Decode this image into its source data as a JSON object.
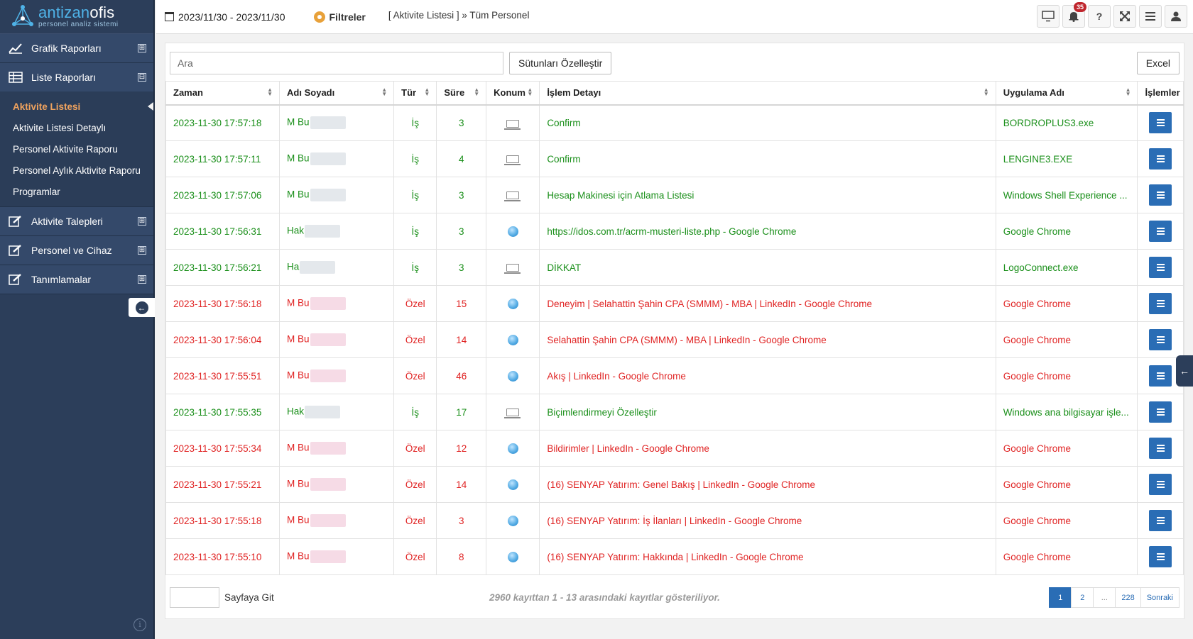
{
  "brand": {
    "name_part1": "antizan",
    "name_part2": "ofis",
    "subtitle": "personel analiz sistemi"
  },
  "sidebar": {
    "groups": [
      {
        "label": "Grafik Raporları",
        "toggle": "⊞",
        "icon": "chart-line-icon"
      },
      {
        "label": "Liste Raporları",
        "toggle": "⊟",
        "icon": "table-icon"
      }
    ],
    "submenu": [
      "Aktivite Listesi",
      "Aktivite Listesi Detaylı",
      "Personel Aktivite Raporu",
      "Personel Aylık Aktivite Raporu",
      "Programlar"
    ],
    "groups_after": [
      {
        "label": "Aktivite Talepleri",
        "toggle": "⊞",
        "icon": "edit-icon"
      },
      {
        "label": "Personel ve Cihaz",
        "toggle": "⊞",
        "icon": "edit-icon"
      },
      {
        "label": "Tanımlamalar",
        "toggle": "⊞",
        "icon": "edit-icon"
      }
    ]
  },
  "topbar": {
    "date_range": "2023/11/30 - 2023/11/30",
    "filters_label": "Filtreler",
    "breadcrumb": "[ Aktivite Listesi ] » Tüm Personel",
    "notification_count": "35",
    "help_label": "?"
  },
  "toolbar": {
    "search_placeholder": "Ara",
    "columns_button": "Sütunları Özelleştir",
    "excel_button": "Excel"
  },
  "table": {
    "headers": [
      "Zaman",
      "Adı Soyadı",
      "Tür",
      "Süre",
      "Konum",
      "İşlem Detayı",
      "Uygulama Adı",
      "İşlemler"
    ],
    "rows": [
      {
        "time": "2023-11-30 17:57:18",
        "name": "M Bu",
        "type": "İş",
        "duration": "3",
        "location": "laptop",
        "detail": "Confirm",
        "app": "BORDROPLUS3.exe",
        "status": "green"
      },
      {
        "time": "2023-11-30 17:57:11",
        "name": "M Bu",
        "type": "İş",
        "duration": "4",
        "location": "laptop",
        "detail": "Confirm",
        "app": "LENGINE3.EXE",
        "status": "green"
      },
      {
        "time": "2023-11-30 17:57:06",
        "name": "M Bu",
        "type": "İş",
        "duration": "3",
        "location": "laptop",
        "detail": "Hesap Makinesi için Atlama Listesi",
        "app": "Windows Shell Experience ...",
        "status": "green"
      },
      {
        "time": "2023-11-30 17:56:31",
        "name": "Hak",
        "type": "İş",
        "duration": "3",
        "location": "globe",
        "detail": "https://idos.com.tr/acrm-musteri-liste.php - Google Chrome",
        "app": "Google Chrome",
        "status": "green"
      },
      {
        "time": "2023-11-30 17:56:21",
        "name": "Ha",
        "type": "İş",
        "duration": "3",
        "location": "laptop",
        "detail": "DİKKAT",
        "app": "LogoConnect.exe",
        "status": "green"
      },
      {
        "time": "2023-11-30 17:56:18",
        "name": "M Bu",
        "type": "Özel",
        "duration": "15",
        "location": "globe",
        "detail": "Deneyim | Selahattin Şahin CPA (SMMM) - MBA | LinkedIn - Google Chrome",
        "app": "Google Chrome",
        "status": "red"
      },
      {
        "time": "2023-11-30 17:56:04",
        "name": "M Bu",
        "type": "Özel",
        "duration": "14",
        "location": "globe",
        "detail": "Selahattin Şahin CPA (SMMM) - MBA | LinkedIn - Google Chrome",
        "app": "Google Chrome",
        "status": "red"
      },
      {
        "time": "2023-11-30 17:55:51",
        "name": "M Bu",
        "type": "Özel",
        "duration": "46",
        "location": "globe",
        "detail": "Akış | LinkedIn - Google Chrome",
        "app": "Google Chrome",
        "status": "red"
      },
      {
        "time": "2023-11-30 17:55:35",
        "name": "Hak",
        "type": "İş",
        "duration": "17",
        "location": "laptop",
        "detail": "Biçimlendirmeyi Özelleştir",
        "app": "Windows ana bilgisayar işle...",
        "status": "green"
      },
      {
        "time": "2023-11-30 17:55:34",
        "name": "M Bu",
        "type": "Özel",
        "duration": "12",
        "location": "globe",
        "detail": "Bildirimler | LinkedIn - Google Chrome",
        "app": "Google Chrome",
        "status": "red"
      },
      {
        "time": "2023-11-30 17:55:21",
        "name": "M Bu",
        "type": "Özel",
        "duration": "14",
        "location": "globe",
        "detail": "(16) SENYAP Yatırım: Genel Bakış | LinkedIn - Google Chrome",
        "app": "Google Chrome",
        "status": "red"
      },
      {
        "time": "2023-11-30 17:55:18",
        "name": "M Bu",
        "type": "Özel",
        "duration": "3",
        "location": "globe",
        "detail": "(16) SENYAP Yatırım: İş İlanları | LinkedIn - Google Chrome",
        "app": "Google Chrome",
        "status": "red"
      },
      {
        "time": "2023-11-30 17:55:10",
        "name": "M Bu",
        "type": "Özel",
        "duration": "8",
        "location": "globe",
        "detail": "(16) SENYAP Yatırım: Hakkında | LinkedIn - Google Chrome",
        "app": "Google Chrome",
        "status": "red"
      }
    ]
  },
  "footer": {
    "goto_label": "Sayfaya Git",
    "info": "2960 kayıttan 1 - 13 arasındaki kayıtlar gösteriliyor.",
    "pages": [
      "1",
      "2",
      "...",
      "228",
      "Sonraki"
    ],
    "active_page": "1"
  },
  "colors": {
    "sidebar": "#2c3e5a",
    "green": "#1a8f1a",
    "red": "#e02323",
    "primary": "#2a6db5",
    "accent": "#f0a35e"
  }
}
